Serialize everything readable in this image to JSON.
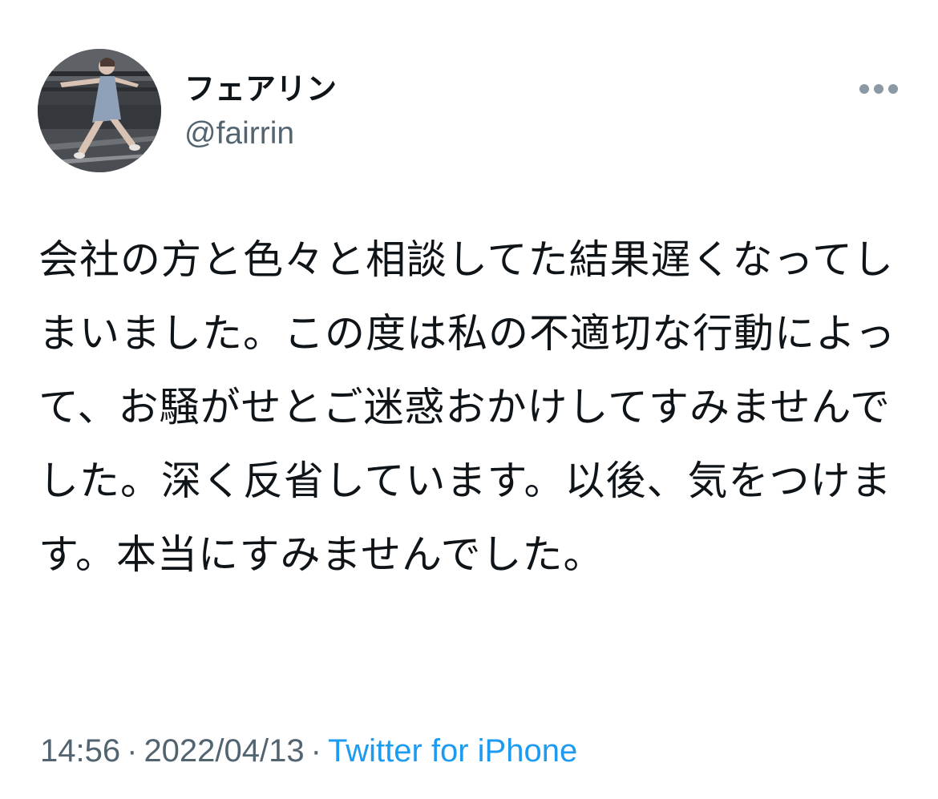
{
  "user": {
    "display_name": "フェアリン",
    "handle": "@fairrin",
    "avatar_icon": "profile-photo"
  },
  "more_icon": "more-horizontal-icon",
  "tweet": {
    "text": "会社の方と色々と相談してた結果遅くなってしまいました。この度は私の不適切な行動によって、お騒がせとご迷惑おかけしてすみませんでした。深く反省しています。以後、気をつけます。本当にすみませんでした。"
  },
  "meta": {
    "time": "14:56",
    "separator": "·",
    "date": "2022/04/13",
    "source": "Twitter for iPhone"
  },
  "colors": {
    "text": "#0f1419",
    "secondary": "#536471",
    "link": "#1d9bf0"
  }
}
